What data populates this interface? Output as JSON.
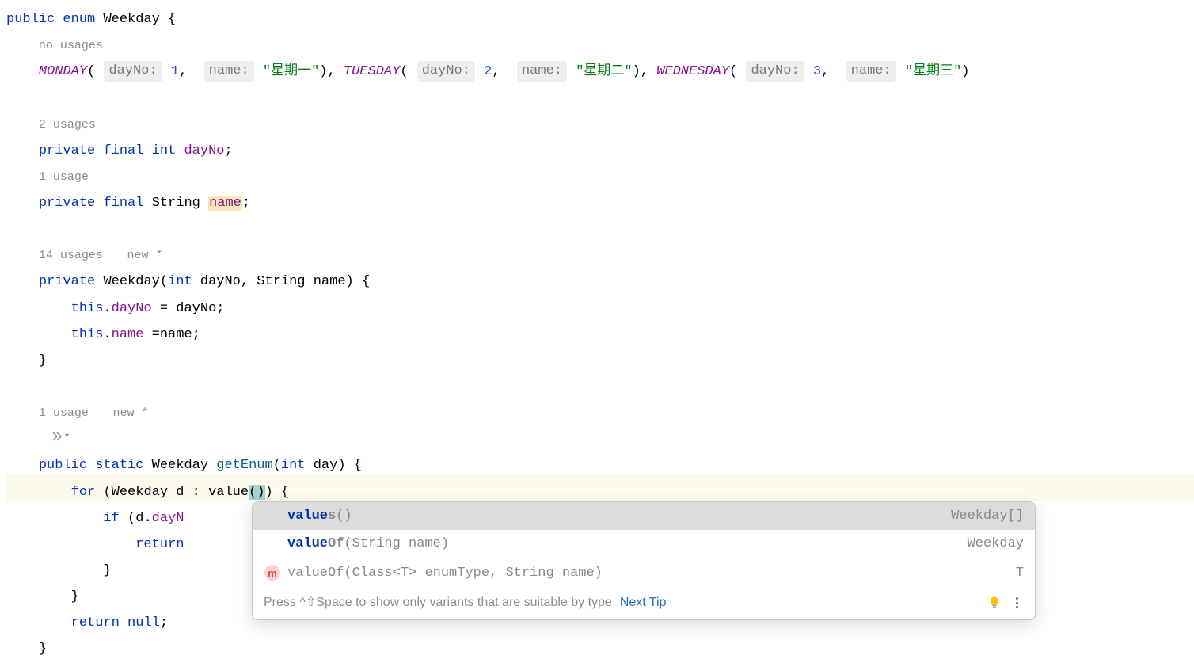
{
  "code": {
    "kw_public": "public",
    "kw_enum": "enum",
    "kw_private": "private",
    "kw_final": "final",
    "kw_int": "int",
    "kw_this": "this",
    "kw_static": "static",
    "kw_for": "for",
    "kw_if": "if",
    "kw_return": "return",
    "kw_null": "null",
    "type_weekday": "Weekday",
    "type_string": "String",
    "enum_monday": "MONDAY",
    "enum_tuesday": "TUESDAY",
    "enum_wednesday": "WEDNESDAY",
    "hint_dayNo": "dayNo:",
    "hint_name": "name:",
    "num_1": "1",
    "num_2": "2",
    "num_3": "3",
    "str_mon": "\"星期一\"",
    "str_tue": "\"星期二\"",
    "str_wed": "\"星期三\"",
    "usage_no": "no usages",
    "usage_2": "2 usages",
    "usage_1": "1 usage",
    "usage_14": "14 usages",
    "usage_new": "new *",
    "field_dayNo": "dayNo",
    "field_name": "name",
    "param_dayNo": "dayNo",
    "param_name": "name",
    "param_day": "day",
    "param_d": "d",
    "method_getEnum": "getEnum",
    "call_value": "value",
    "paren_caret": "()",
    "partial_dayN": "dayN",
    "partial_return": "return",
    "brace_open": "{",
    "brace_close": "}",
    "paren_open": "(",
    "paren_close_comma_space": ", ",
    "paren_close_paren": ")",
    "semicolon": ";",
    "comma_space": ", ",
    "dot": ".",
    "equals_sp": " = ",
    "equals": " =",
    "colon": " : ",
    "space": " "
  },
  "popup": {
    "rows": [
      {
        "match": "value",
        "bold_suffix": "s",
        "rest": "()",
        "right": "Weekday[]"
      },
      {
        "match": "value",
        "bold_suffix": "Of",
        "rest": "(String name)",
        "right": "Weekday"
      },
      {
        "m_badge": "m",
        "plain_pre": "valueOf",
        "rest": "(Class<T> enumType, String name)",
        "right": "T"
      }
    ],
    "footer_hint": "Press ^⇧Space to show only variants that are suitable by type",
    "footer_link": "Next Tip"
  }
}
